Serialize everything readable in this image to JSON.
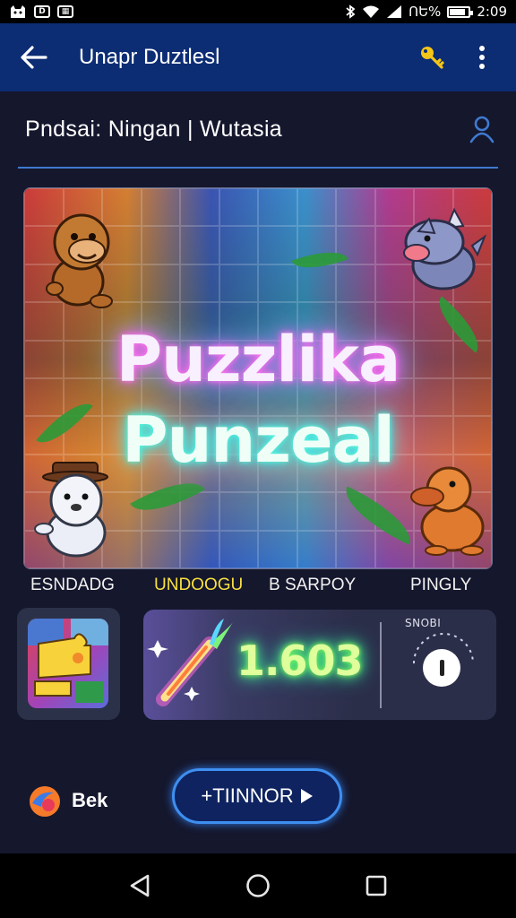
{
  "status_bar": {
    "battery_text": "ՈԵ%",
    "battery_level": 0.85,
    "time": "2:09"
  },
  "app_bar": {
    "title": "Unapr Duztlesl",
    "back_icon": "arrow-left-icon",
    "key_icon": "key-icon",
    "more_icon": "more-vert-icon"
  },
  "sub_header": {
    "title": "Pndsai: Ningan | Wutasia",
    "profile_icon": "person-icon"
  },
  "banner": {
    "line1": "Puzzlika",
    "line2": "Punzeal"
  },
  "tabs": [
    {
      "label": "ESNDADG"
    },
    {
      "label": "UNDOOGU"
    },
    {
      "label": "B SARPOY"
    },
    {
      "label": "PINGLY"
    }
  ],
  "score_card": {
    "value": "1.603",
    "timer_label": "SNOBI"
  },
  "bottom": {
    "beta_label": "Bek",
    "primary_label": "+TIINNOR"
  },
  "colors": {
    "app_bar": "#0c2c74",
    "background": "#15172d",
    "accent": "#3e8ff0",
    "active_tab": "#f8e040"
  }
}
